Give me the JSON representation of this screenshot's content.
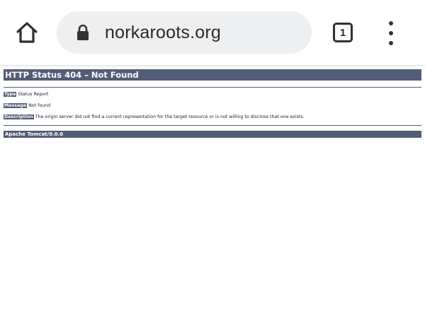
{
  "browser": {
    "url": "norkaroots.org",
    "tab_count": "1"
  },
  "page": {
    "title": "HTTP Status 404 – Not Found",
    "type_label": "Type",
    "type_value": "Status Report",
    "message_label": "Message",
    "message_value": "Not found",
    "description_label": "Description",
    "description_value": "The origin server did not find a current representation for the target resource or is not willing to disclose that one exists.",
    "server": "Apache Tomcat/9.0.6"
  },
  "colors": {
    "tomcat_header": "#525d76",
    "omnibox_bg": "#eeeff1"
  }
}
